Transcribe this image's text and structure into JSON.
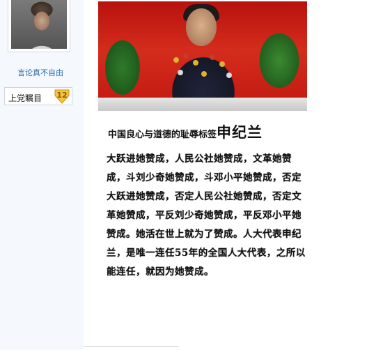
{
  "sidebar": {
    "username": "言论真不自由",
    "tag": {
      "label": "上党瞩目",
      "badge": "12"
    }
  },
  "article": {
    "headline_prefix": "中国良心与道德的耻辱标签",
    "headline_name": "申纪兰",
    "body": "大跃进她赞成，人民公社她赞成，文革她赞成，斗刘少奇她赞成，斗邓小平她赞成，否定大跃进她赞成，否定人民公社她赞成，否定文革她赞成，平反刘少奇她赞成，平反邓小平她赞成。她活在世上就为了赞成。人大代表申纪兰，是唯一连任55年的全国人大代表，之所以能连任，就因为她赞成。"
  },
  "colors": {
    "sidebar_bg": "#f5f8fc",
    "link": "#2e6bb0",
    "badge": "#f5c542"
  }
}
